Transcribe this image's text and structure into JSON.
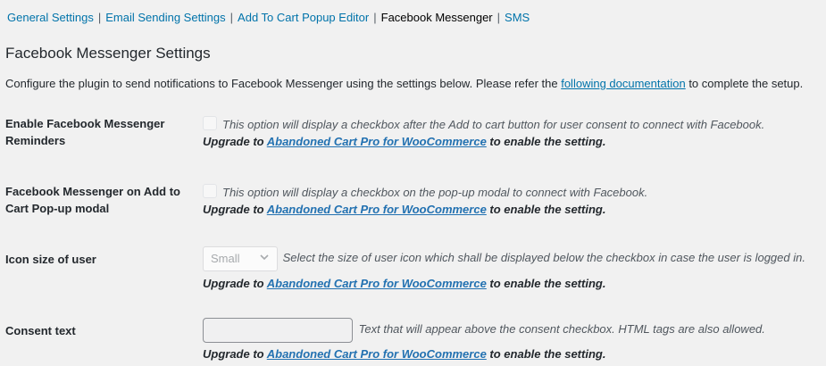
{
  "subnav": {
    "items": [
      {
        "label": "General Settings",
        "current": false
      },
      {
        "label": "Email Sending Settings",
        "current": false
      },
      {
        "label": "Add To Cart Popup Editor",
        "current": false
      },
      {
        "label": "Facebook Messenger",
        "current": true
      },
      {
        "label": "SMS",
        "current": false
      }
    ],
    "separator": "|"
  },
  "page": {
    "title": "Facebook Messenger Settings",
    "intro_before": "Configure the plugin to send notifications to Facebook Messenger using the settings below. Please refer the ",
    "intro_link": "following documentation",
    "intro_after": " to complete the setup."
  },
  "upgrade": {
    "before": "Upgrade to ",
    "link": "Abandoned Cart Pro for WooCommerce",
    "after": " to enable the setting."
  },
  "settings": {
    "enable_reminders": {
      "label": "Enable Facebook Messenger Reminders",
      "description": "This option will display a checkbox after the Add to cart button for user consent to connect with Facebook."
    },
    "popup_modal": {
      "label": "Facebook Messenger on Add to Cart Pop-up modal",
      "description": "This option will display a checkbox on the pop-up modal to connect with Facebook."
    },
    "icon_size": {
      "label": "Icon size of user",
      "selected": "Small",
      "description": "Select the size of user icon which shall be displayed below the checkbox in case the user is logged in."
    },
    "consent_text": {
      "label": "Consent text",
      "value": "",
      "description": "Text that will appear above the consent checkbox. HTML tags are also allowed."
    }
  }
}
